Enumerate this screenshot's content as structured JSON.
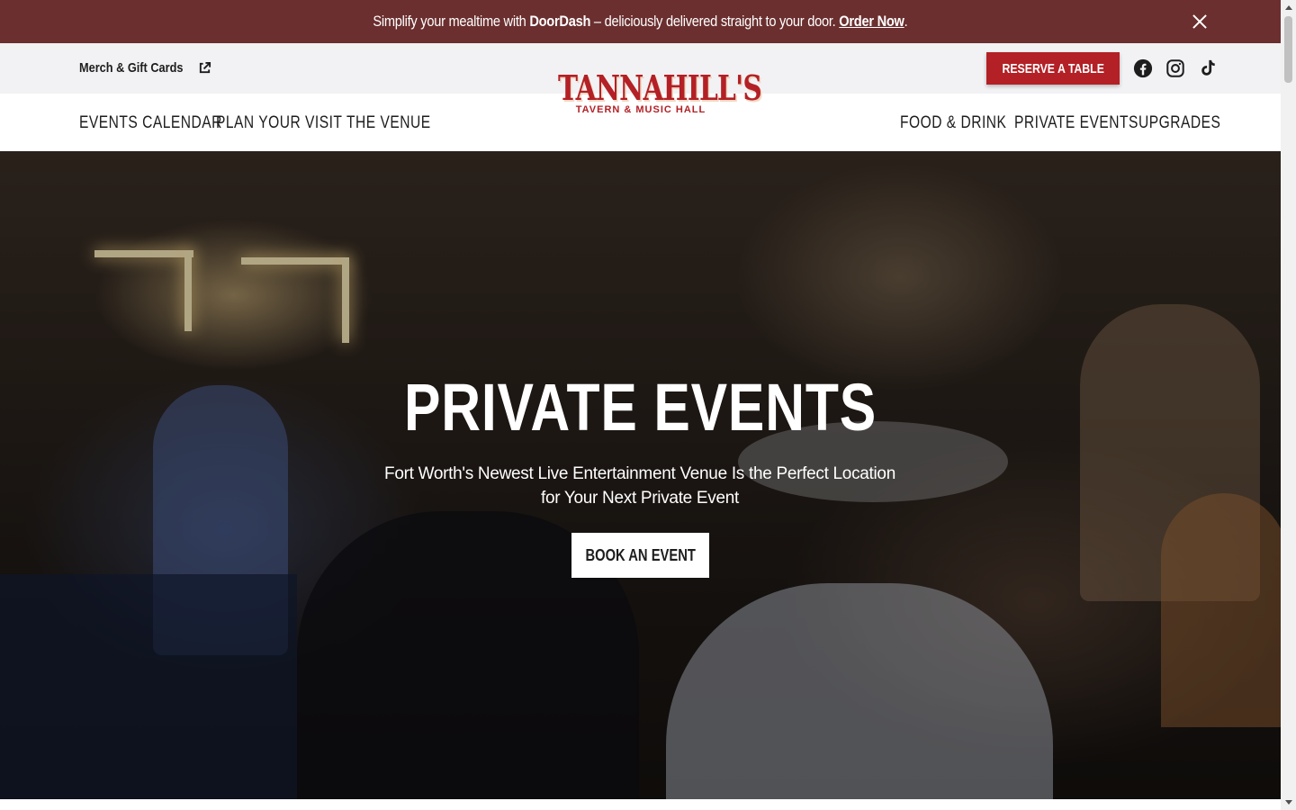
{
  "announcement": {
    "prefix": "Simplify your mealtime with",
    "brand": "DoorDash",
    "middle": " – deliciously delivered straight to your door.",
    "link": "Order Now",
    "suffix": ".",
    "background": "#6b2f2f"
  },
  "utility": {
    "merch_label": "Merch & Gift Cards",
    "reserve_label": "RESERVE A TABLE",
    "social": [
      "facebook-icon",
      "instagram-icon",
      "tiktok-icon"
    ]
  },
  "logo": {
    "wordmark": "TANNAHILL'S",
    "subtitle": "TAVERN & MUSIC HALL"
  },
  "nav": {
    "left": [
      "EVENTS CALENDAR",
      "PLAN YOUR VISIT",
      "THE VENUE"
    ],
    "right": [
      "FOOD & DRINK",
      "PRIVATE EVENTS",
      "UPGRADES"
    ]
  },
  "hero": {
    "title": "PRIVATE EVENTS",
    "subtitle_line1": "Fort Worth's Newest Live Entertainment Venue Is the Perfect Location",
    "subtitle_line2": "for Your Next Private Event",
    "cta": "BOOK AN EVENT"
  },
  "colors": {
    "accent": "#b32025",
    "announce_bg": "#6b2f2f",
    "utility_bg": "#f2f2f4"
  }
}
